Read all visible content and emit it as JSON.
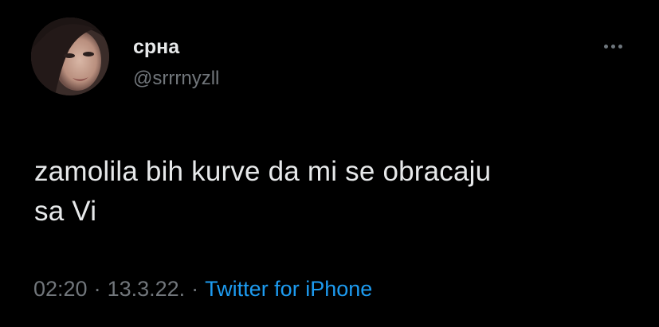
{
  "tweet": {
    "display_name": "срна",
    "handle": "@srrrnyzll",
    "text_line1": "zamolila bih kurve da mi se obracaju",
    "text_line2": "sa Vi",
    "time": "02:20",
    "separator": "·",
    "date": "13.3.22.",
    "source": "Twitter for iPhone"
  },
  "icons": {
    "more": "more-horizontal-icon",
    "avatar": "profile-photo"
  },
  "colors": {
    "background": "#000000",
    "primary_text": "#e7e9ea",
    "secondary_text": "#71767b",
    "link": "#1d9bf0"
  }
}
